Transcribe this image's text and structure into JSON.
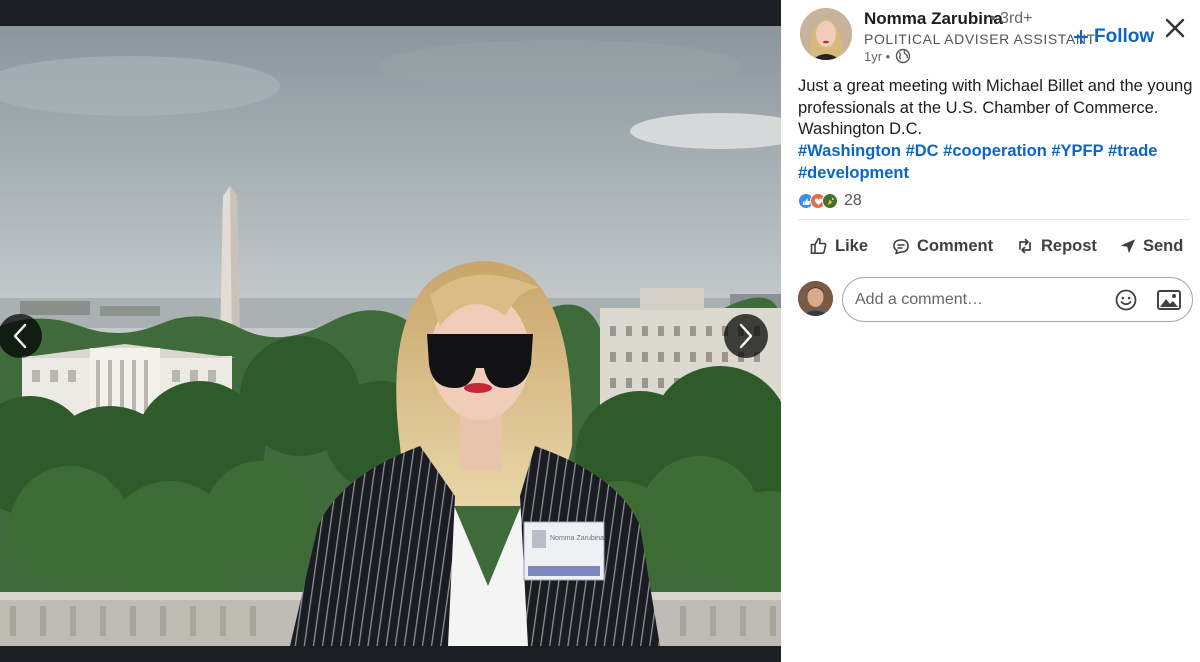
{
  "viewer": {
    "image_alt": "Woman in sunglasses and pinstripe blazer on a rooftop in Washington D.C., with the Washington Monument and White House behind her",
    "badge_name": "Nomma Zarubina",
    "prev_icon": "chevron-left-icon",
    "next_icon": "chevron-right-icon"
  },
  "post": {
    "author": {
      "name": "Nomma Zarubina",
      "degree": "• 3rd+",
      "title": "POLITICAL ADVISER ASSISTANT",
      "age": "1yr •",
      "visibility_icon": "globe-icon"
    },
    "follow_label": "Follow",
    "text_lines": [
      "Just a great meeting with Michael Billet and the young",
      "professionals at the U.S. Chamber of Commerce.",
      "Washington D.C."
    ],
    "hashtags": [
      "#Washington",
      "#DC",
      "#cooperation",
      "#YPFP",
      "#trade",
      "#development"
    ],
    "reactions": {
      "icons": [
        "like-reaction-icon",
        "love-reaction-icon",
        "celebrate-reaction-icon"
      ],
      "count": "28"
    },
    "actions": {
      "like": "Like",
      "comment": "Comment",
      "repost": "Repost",
      "send": "Send"
    },
    "comment": {
      "placeholder": "Add a comment…"
    }
  },
  "colors": {
    "brand": "#0a66c2",
    "viewer_background": "#1b1f23"
  }
}
